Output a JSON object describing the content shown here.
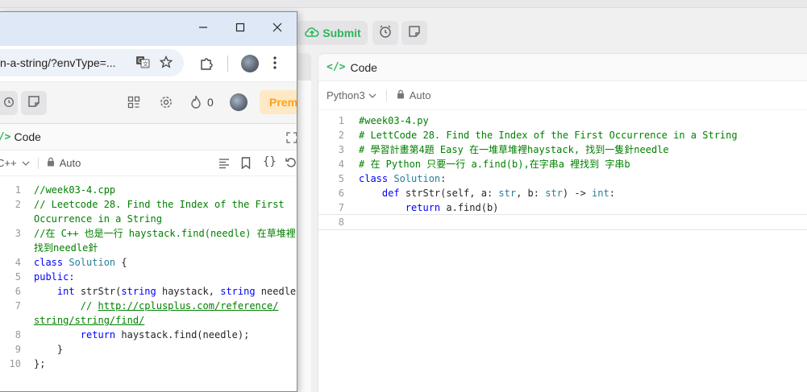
{
  "bg": {
    "submit_label": "Submit",
    "panel_title": "Code",
    "language": "Python3",
    "auto_label": "Auto",
    "code_lines": [
      {
        "n": "1",
        "parts": [
          {
            "t": "#week03-4.py",
            "c": "c-com"
          }
        ]
      },
      {
        "n": "2",
        "parts": [
          {
            "t": "# LettCode 28. Find the Index of the First Occurrence in a String",
            "c": "c-com"
          }
        ]
      },
      {
        "n": "3",
        "parts": [
          {
            "t": "# 學習計畫第4題 Easy 在一堆草堆裡haystack, 找到一隻針needle",
            "c": "c-com"
          }
        ]
      },
      {
        "n": "4",
        "parts": [
          {
            "t": "# 在 Python 只要一行 a.find(b),在字串a 裡找到 字串b",
            "c": "c-com"
          }
        ]
      },
      {
        "n": "5",
        "parts": [
          {
            "t": "class ",
            "c": "c-kw"
          },
          {
            "t": "Solution",
            "c": "c-cls"
          },
          {
            "t": ":",
            "c": "c-plain"
          }
        ]
      },
      {
        "n": "6",
        "parts": [
          {
            "t": "    ",
            "c": "c-plain"
          },
          {
            "t": "def ",
            "c": "c-kw"
          },
          {
            "t": "strStr(self, a: ",
            "c": "c-plain"
          },
          {
            "t": "str",
            "c": "c-cls"
          },
          {
            "t": ", b: ",
            "c": "c-plain"
          },
          {
            "t": "str",
            "c": "c-cls"
          },
          {
            "t": ") -> ",
            "c": "c-plain"
          },
          {
            "t": "int",
            "c": "c-cls"
          },
          {
            "t": ":",
            "c": "c-plain"
          }
        ]
      },
      {
        "n": "7",
        "parts": [
          {
            "t": "        ",
            "c": "c-plain"
          },
          {
            "t": "return ",
            "c": "c-kw"
          },
          {
            "t": "a.find(b)",
            "c": "c-plain"
          }
        ]
      },
      {
        "n": "8",
        "parts": [
          {
            "t": "",
            "c": "c-plain"
          }
        ]
      }
    ]
  },
  "browser": {
    "url_fragment": "n-a-string/?envType=...",
    "profile_badge_count": "0",
    "premium_label": "Prem",
    "panel_title": "Code",
    "language": "C++",
    "auto_label": "Auto",
    "code_lines": [
      {
        "n": "1",
        "parts": [
          {
            "t": "//week03-4.cpp",
            "c": "c-com"
          }
        ]
      },
      {
        "n": "2",
        "parts": [
          {
            "t": "// Leetcode 28. Find the Index of the First",
            "c": "c-com"
          }
        ]
      },
      {
        "n": "",
        "parts": [
          {
            "t": "Occurrence in a String",
            "c": "c-com"
          }
        ]
      },
      {
        "n": "3",
        "parts": [
          {
            "t": "//在 C++ 也是一行 haystack.find(needle) 在草堆裡",
            "c": "c-com"
          }
        ]
      },
      {
        "n": "",
        "parts": [
          {
            "t": "找到needle針",
            "c": "c-com"
          }
        ]
      },
      {
        "n": "4",
        "parts": [
          {
            "t": "class ",
            "c": "c-kw"
          },
          {
            "t": "Solution",
            "c": "c-cls"
          },
          {
            "t": " {",
            "c": "c-plain"
          }
        ]
      },
      {
        "n": "5",
        "parts": [
          {
            "t": "public:",
            "c": "c-kw"
          }
        ]
      },
      {
        "n": "6",
        "parts": [
          {
            "t": "    ",
            "c": "c-plain"
          },
          {
            "t": "int ",
            "c": "c-kw"
          },
          {
            "t": "strStr(",
            "c": "c-plain"
          },
          {
            "t": "string ",
            "c": "c-kw"
          },
          {
            "t": "haystack, ",
            "c": "c-plain"
          },
          {
            "t": "string ",
            "c": "c-kw"
          },
          {
            "t": "needle)",
            "c": "c-plain"
          }
        ]
      },
      {
        "n": "7",
        "parts": [
          {
            "t": "        // ",
            "c": "c-com"
          },
          {
            "t": "http://cplusplus.com/reference/",
            "c": "c-link"
          }
        ]
      },
      {
        "n": "",
        "parts": [
          {
            "t": "string/string/find/",
            "c": "c-link"
          }
        ]
      },
      {
        "n": "8",
        "parts": [
          {
            "t": "        ",
            "c": "c-plain"
          },
          {
            "t": "return ",
            "c": "c-kw"
          },
          {
            "t": "haystack.find(needle);",
            "c": "c-plain"
          }
        ]
      },
      {
        "n": "9",
        "parts": [
          {
            "t": "    }",
            "c": "c-plain"
          }
        ]
      },
      {
        "n": "10",
        "parts": [
          {
            "t": "};",
            "c": "c-plain"
          }
        ]
      }
    ]
  },
  "colors": {
    "submit_green": "#2db55d",
    "premium_orange": "#ffa116",
    "comment_green": "#008000",
    "keyword_blue": "#0000ff",
    "type_teal": "#267f99"
  }
}
